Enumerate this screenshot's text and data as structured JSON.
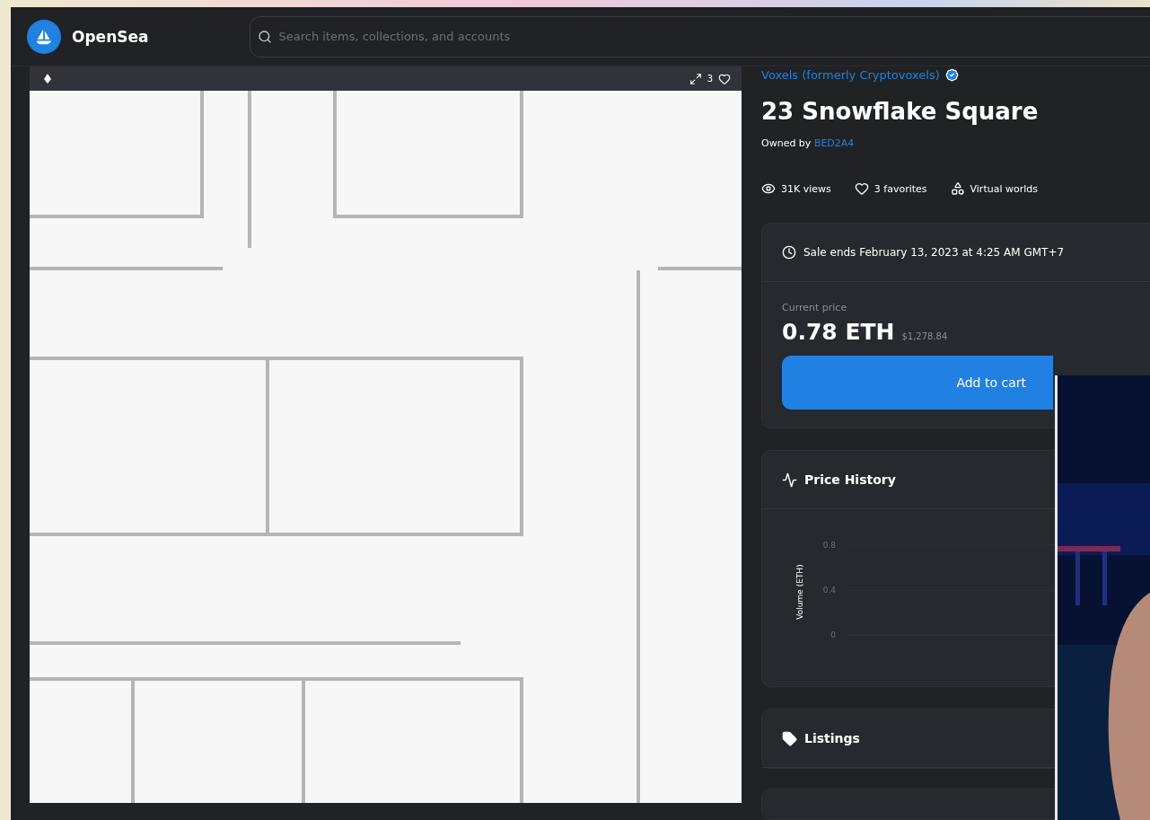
{
  "header": {
    "logo_text": "OpenSea",
    "search": {
      "placeholder": "Search items, collections, and accounts"
    }
  },
  "image_toolbar": {
    "favorites_count": "3"
  },
  "item": {
    "collection": "Voxels (formerly Cryptovoxels)",
    "verified": true,
    "title": "23 Snowflake Square",
    "owned_by_label": "Owned by",
    "owner": "BED2A4",
    "stats": [
      {
        "kind": "views",
        "label": "31K views"
      },
      {
        "kind": "favorites",
        "label": "3 favorites"
      },
      {
        "kind": "category",
        "label": "Virtual worlds"
      }
    ]
  },
  "sale": {
    "ends": "Sale ends February 13, 2023 at 4:25 AM GMT+7",
    "price_label": "Current price",
    "price": "0.78 ETH",
    "price_usd": "$1,278.84",
    "button": "Add to cart"
  },
  "price_history": {
    "title": "Price History",
    "axis_label": "Volume (ETH)",
    "tick_labels": [
      "0.8",
      "0.4",
      "0"
    ]
  },
  "listings": {
    "title": "Listings"
  }
}
